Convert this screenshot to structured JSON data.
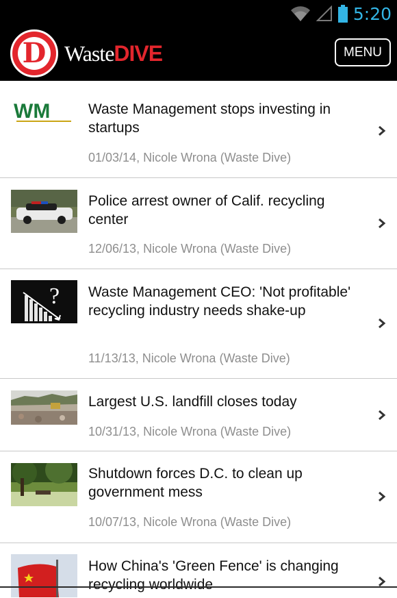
{
  "status": {
    "time": "5:20"
  },
  "header": {
    "brand_waste": "Waste",
    "brand_dive": "DIVE",
    "logo_letter": "D",
    "menu_label": "MENU"
  },
  "articles": [
    {
      "title": "Waste Management stops investing in startups",
      "meta": "01/03/14, Nicole Wrona (Waste Dive)",
      "thumb": "wm-logo",
      "thumb_text": "WM"
    },
    {
      "title": "Police arrest owner of Calif. recycling center",
      "meta": "12/06/13, Nicole Wrona (Waste Dive)",
      "thumb": "police-car-photo"
    },
    {
      "title": "Waste Management CEO: 'Not profitable' recycling industry needs shake-up",
      "meta": "11/13/13, Nicole Wrona (Waste Dive)",
      "thumb": "declining-chart-question",
      "thumb_text": "?"
    },
    {
      "title": "Largest U.S. landfill closes today",
      "meta": "10/31/13, Nicole Wrona (Waste Dive)",
      "thumb": "landfill-photo"
    },
    {
      "title": "Shutdown forces D.C. to clean up government mess",
      "meta": "10/07/13, Nicole Wrona (Waste Dive)",
      "thumb": "park-photo"
    },
    {
      "title": "How China's 'Green Fence' is changing recycling worldwide",
      "meta": "",
      "thumb": "china-flag-photo"
    }
  ],
  "colors": {
    "accent": "#e3262d",
    "status_time": "#33b5e5",
    "meta_text": "#8e8e8e"
  }
}
